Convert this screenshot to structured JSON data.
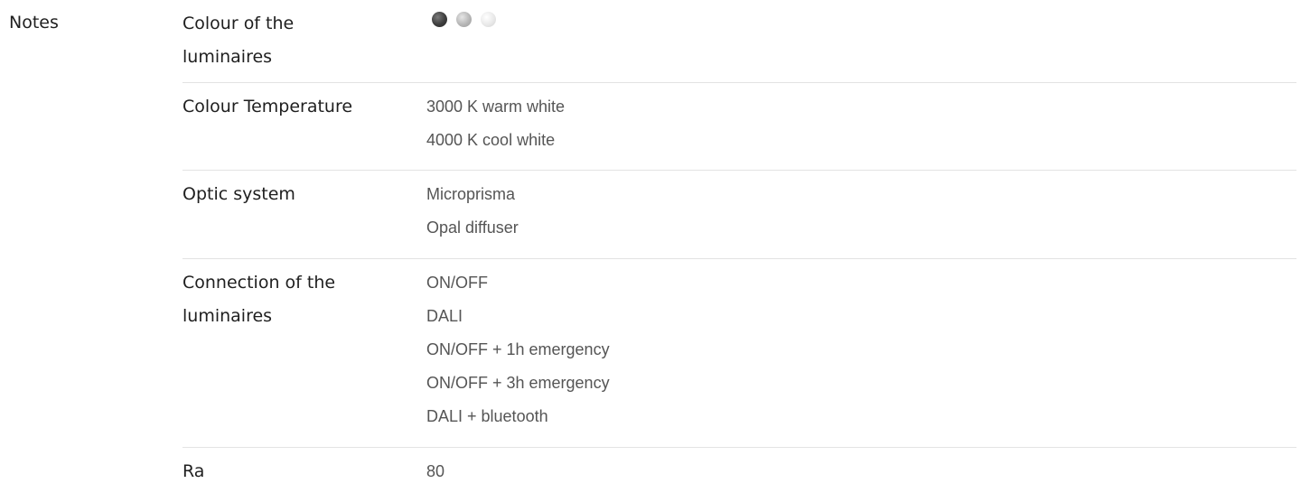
{
  "section": {
    "label": "Notes"
  },
  "rows": {
    "colour_of_luminaires": {
      "label_line1": "Colour of the",
      "label_line2": "luminaires",
      "swatches": [
        {
          "name": "dark-grey",
          "color": "#3d3d3d"
        },
        {
          "name": "silver-grey",
          "color": "#b6b6b6"
        },
        {
          "name": "light-grey",
          "color": "#e9e9e9"
        }
      ]
    },
    "colour_temperature": {
      "label": "Colour Temperature",
      "values": [
        "3000 K warm white",
        "4000 K cool white"
      ]
    },
    "optic_system": {
      "label": "Optic system",
      "values": [
        "Microprisma",
        "Opal diffuser"
      ]
    },
    "connection": {
      "label_line1": "Connection of the",
      "label_line2": "luminaires",
      "values": [
        "ON/OFF",
        "DALI",
        "ON/OFF + 1h emergency",
        "ON/OFF + 3h emergency",
        "DALI + bluetooth"
      ]
    },
    "ra": {
      "label": "Ra",
      "values": [
        "80"
      ]
    }
  },
  "colors": {
    "text_primary": "#1f1f1f",
    "text_secondary": "#555555",
    "divider": "#e3e3e3",
    "background": "#ffffff"
  }
}
